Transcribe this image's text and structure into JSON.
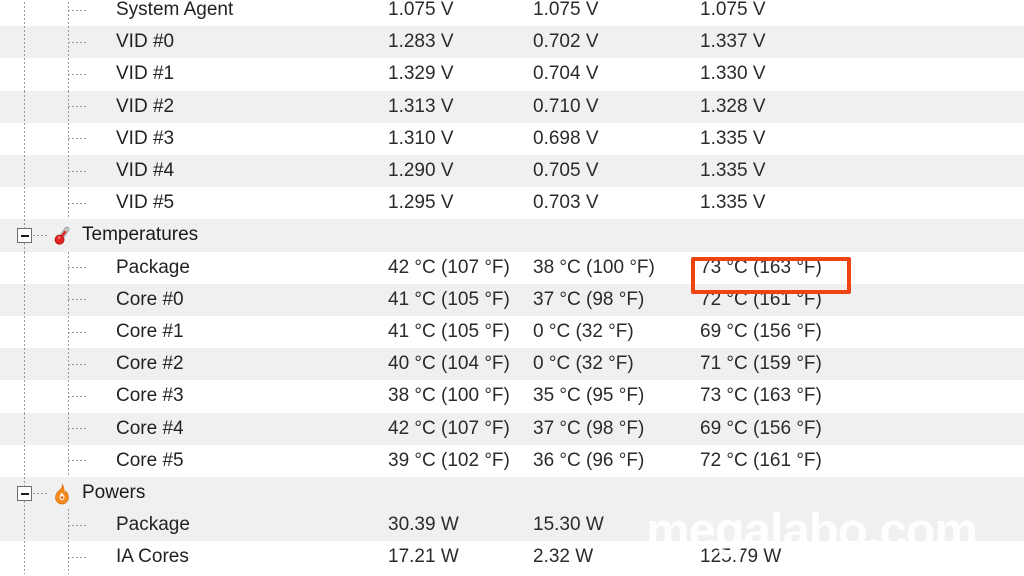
{
  "watermark": {
    "text": "megalabo.com"
  },
  "highlight": {
    "color": "#ee4411"
  },
  "columns": {
    "count": 3
  },
  "rows": [
    {
      "kind": "leaf",
      "label": "System Agent",
      "values": [
        "1.075 V",
        "1.075 V",
        "1.075 V"
      ],
      "shade": "plain"
    },
    {
      "kind": "leaf",
      "label": "VID #0",
      "values": [
        "1.283 V",
        "0.702 V",
        "1.337 V"
      ],
      "shade": "alt"
    },
    {
      "kind": "leaf",
      "label": "VID #1",
      "values": [
        "1.329 V",
        "0.704 V",
        "1.330 V"
      ],
      "shade": "plain"
    },
    {
      "kind": "leaf",
      "label": "VID #2",
      "values": [
        "1.313 V",
        "0.710 V",
        "1.328 V"
      ],
      "shade": "alt"
    },
    {
      "kind": "leaf",
      "label": "VID #3",
      "values": [
        "1.310 V",
        "0.698 V",
        "1.335 V"
      ],
      "shade": "plain"
    },
    {
      "kind": "leaf",
      "label": "VID #4",
      "values": [
        "1.290 V",
        "0.705 V",
        "1.335 V"
      ],
      "shade": "alt"
    },
    {
      "kind": "leaf",
      "label": "VID #5",
      "values": [
        "1.295 V",
        "0.703 V",
        "1.335 V"
      ],
      "shade": "plain"
    },
    {
      "kind": "category",
      "label": "Temperatures",
      "icon": "thermometer-icon",
      "values": [
        "",
        "",
        ""
      ],
      "shade": "alt"
    },
    {
      "kind": "leaf",
      "label": "Package",
      "values": [
        "42 °C  (107 °F)",
        "38 °C  (100 °F)",
        "73 °C  (163 °F)"
      ],
      "shade": "plain"
    },
    {
      "kind": "leaf",
      "label": "Core #0",
      "values": [
        "41 °C  (105 °F)",
        "37 °C  (98 °F)",
        "72 °C  (161 °F)"
      ],
      "shade": "alt"
    },
    {
      "kind": "leaf",
      "label": "Core #1",
      "values": [
        "41 °C  (105 °F)",
        "0 °C  (32 °F)",
        "69 °C  (156 °F)"
      ],
      "shade": "plain"
    },
    {
      "kind": "leaf",
      "label": "Core #2",
      "values": [
        "40 °C  (104 °F)",
        "0 °C  (32 °F)",
        "71 °C  (159 °F)"
      ],
      "shade": "alt"
    },
    {
      "kind": "leaf",
      "label": "Core #3",
      "values": [
        "38 °C  (100 °F)",
        "35 °C  (95 °F)",
        "73 °C  (163 °F)"
      ],
      "shade": "plain"
    },
    {
      "kind": "leaf",
      "label": "Core #4",
      "values": [
        "42 °C  (107 °F)",
        "37 °C  (98 °F)",
        "69 °C  (156 °F)"
      ],
      "shade": "alt"
    },
    {
      "kind": "leaf",
      "label": "Core #5",
      "values": [
        "39 °C  (102 °F)",
        "36 °C  (96 °F)",
        "72 °C  (161 °F)"
      ],
      "shade": "plain"
    },
    {
      "kind": "category",
      "label": "Powers",
      "icon": "flame-icon",
      "values": [
        "",
        "",
        ""
      ],
      "shade": "alt"
    },
    {
      "kind": "leaf",
      "label": "Package",
      "values": [
        "30.39 W",
        "15.30 W",
        ""
      ],
      "shade": "alt"
    },
    {
      "kind": "leaf",
      "label": "IA Cores",
      "values": [
        "17.21 W",
        "2.32 W",
        "125.79 W"
      ],
      "shade": "plain"
    }
  ]
}
